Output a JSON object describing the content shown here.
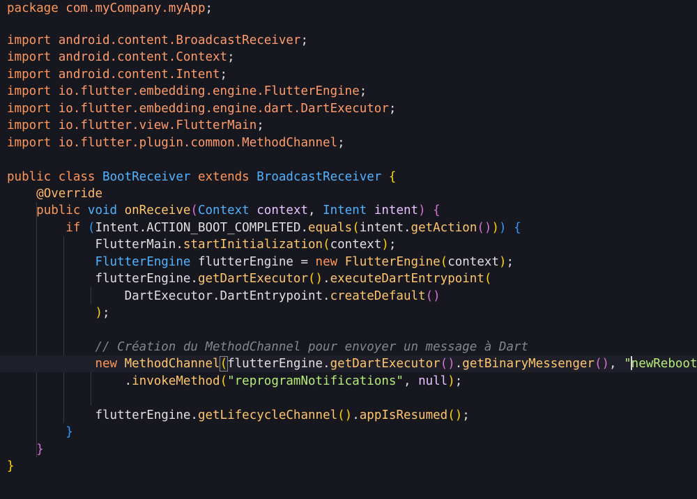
{
  "editor": {
    "language": "Java",
    "theme_colors": {
      "background": "#171720",
      "keyword": "#ff9757",
      "type": "#4fb3ff",
      "function": "#ffc66d",
      "string": "#b6ec7a",
      "comment": "#85858f",
      "bracket_level_1": "#ffd700",
      "bracket_level_2": "#da70d6",
      "bracket_level_3": "#2f9bff"
    },
    "tokens": {
      "l1_kw": "package",
      "l1_pkg": " com.myCompany.myApp",
      "l1_end": ";",
      "imp": "import",
      "l3_path": " android.content.BroadcastReceiver",
      "l4_path": " android.content.Context",
      "l5_path": " android.content.Intent",
      "l6_path": " io.flutter.embedding.engine.FlutterEngine",
      "l7_path": " io.flutter.embedding.engine.dart.DartExecutor",
      "l8_path": " io.flutter.view.FlutterMain",
      "l9_path": " io.flutter.plugin.common.MethodChannel",
      "semi": ";",
      "l11_public": "public",
      "l11_class": " class ",
      "l11_name": "BootReceiver",
      "l11_extends": " extends ",
      "l11_super": "BroadcastReceiver",
      "l11_brace": " {",
      "l12_ann": "@Override",
      "l13_public": "public",
      "l13_void": " void ",
      "l13_fn": "onReceive",
      "l13_open": "(",
      "l13_t1": "Context",
      "l13_v1": " context",
      "l13_comma": ", ",
      "l13_t2": "Intent",
      "l13_v2": " intent",
      "l13_close": ")",
      "l13_brace": " {",
      "l14_if": "if ",
      "l14_open": "(",
      "l14_expr": "Intent.ACTION_BOOT_COMPLETED.",
      "l14_equals": "equals",
      "l14_open2": "(",
      "l14_intent": "intent.",
      "l14_getAction": "getAction",
      "l14_call": "()",
      "l14_close2": ")",
      "l14_close": ")",
      "l14_brace": " {",
      "l15_obj": "FlutterMain.",
      "l15_fn": "startInitialization",
      "l15_open": "(",
      "l15_arg": "context",
      "l15_close": ")",
      "l15_semi": ";",
      "l16_type": "FlutterEngine",
      "l16_var": " flutterEngine = ",
      "l16_new": "new ",
      "l16_ctor": "FlutterEngine",
      "l16_open": "(",
      "l16_arg": "context",
      "l16_close": ")",
      "l16_semi": ";",
      "l17_obj": "flutterEngine.",
      "l17_fn1": "getDartExecutor",
      "l17_call": "()",
      "l17_dot": ".",
      "l17_fn2": "executeDartEntrypoint",
      "l17_open": "(",
      "l18_obj": "DartExecutor.DartEntrypoint.",
      "l18_fn": "createDefault",
      "l18_call": "()",
      "l19_close": ")",
      "l19_semi": ";",
      "l21_comment": "// Création du MethodChannel pour envoyer un message à Dart",
      "l22_new": "new ",
      "l22_ctor": "MethodChannel",
      "l22_open": "(",
      "l22_obj": "flutterEngine.",
      "l22_fn1": "getDartExecutor",
      "l22_call1": "()",
      "l22_dot": ".",
      "l22_fn2": "getBinaryMessenger",
      "l22_call2": "()",
      "l22_comma": ", ",
      "l22_q": "\"",
      "l22_str": "newReboot\"",
      "l22_close": ")",
      "l23_dot": ".",
      "l23_fn": "invokeMethod",
      "l23_open": "(",
      "l23_str": "\"reprogramNotifications\"",
      "l23_comma": ", ",
      "l23_null": "null",
      "l23_close": ")",
      "l23_semi": ";",
      "l25_obj": "flutterEngine.",
      "l25_fn1": "getLifecycleChannel",
      "l25_call": "()",
      "l25_dot": ".",
      "l25_fn2": "appIsResumed",
      "l25_call2": "()",
      "l25_semi": ";",
      "l26_brace": "}",
      "l27_brace": "}",
      "l28_brace": "}"
    }
  }
}
